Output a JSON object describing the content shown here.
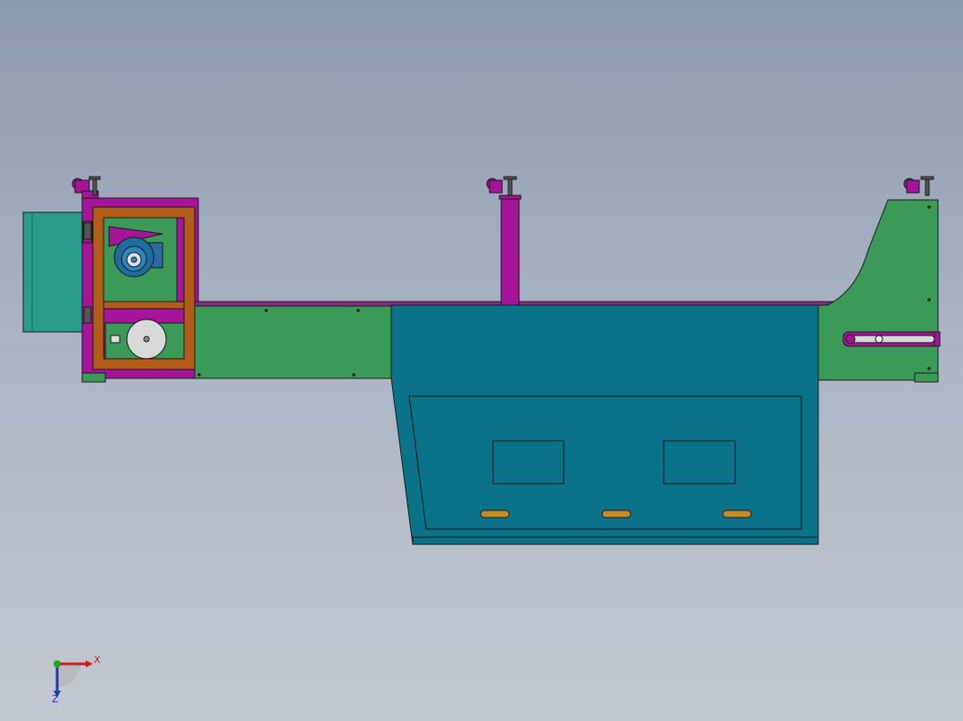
{
  "viewport": {
    "background_top": "#8c9aae",
    "background_bottom": "#c3c9d2"
  },
  "colors": {
    "frame_green": "#3b9a57",
    "tank_teal": "#0b7389",
    "magenta": "#a6149a",
    "control_box": "#2a9c8c",
    "orange_guard": "#b25c1a",
    "motor_blue": "#1f6da0",
    "edge": "#1a1a1a"
  },
  "model": {
    "parts": [
      "control-box",
      "motor-guard",
      "base-frame",
      "coolant-tank",
      "support-column",
      "end-bracket",
      "caster-wheel",
      "leveling-foot",
      "saw-blade",
      "drive-motor"
    ]
  },
  "triad": {
    "x_label": "X",
    "z_label": "Z",
    "x_color": "#c81e1e",
    "y_color": "#1fa81f",
    "z_color": "#1e3ca8"
  }
}
